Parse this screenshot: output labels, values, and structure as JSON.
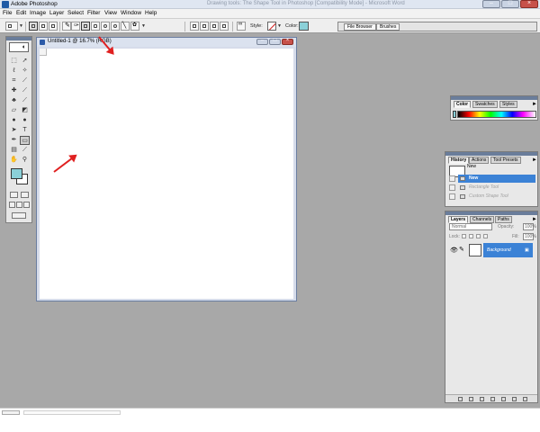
{
  "window": {
    "title": "Adobe Photoshop",
    "background_tab_text": "Drawing tools: The Shape Tool in Photoshop [Compatibility Mode] - Microsoft Word",
    "minimize_glyph": "–",
    "maximize_glyph": "□",
    "close_glyph": "×"
  },
  "menubar": {
    "items": [
      "File",
      "Edit",
      "Image",
      "Layer",
      "Select",
      "Filter",
      "View",
      "Window",
      "Help"
    ]
  },
  "options_bar": {
    "style_label": "Style:",
    "color_label": "Color:",
    "color_value": "#8bd0d8",
    "well_tabs": [
      "File Browser",
      "Brushes"
    ]
  },
  "toolbox": {
    "foreground_color": "#8bd0d8",
    "background_color": "#ffffff",
    "selected_tool": "rectangle-shape-tool"
  },
  "document": {
    "title": "Untitled-1 @ 16.7% (RGB)"
  },
  "color_palette": {
    "tabs": [
      "Color",
      "Swatches",
      "Styles"
    ],
    "active_tab": "Color"
  },
  "history_palette": {
    "tabs": [
      "History",
      "Actions",
      "Tool Presets"
    ],
    "snapshot_label": "New",
    "steps": [
      {
        "label": "New",
        "state": "selected"
      },
      {
        "label": "Rectangle Tool",
        "state": "undone"
      },
      {
        "label": "Custom Shape Tool",
        "state": "undone"
      }
    ]
  },
  "layers_palette": {
    "tabs": [
      "Layers",
      "Channels",
      "Paths"
    ],
    "blend_mode": "Normal",
    "opacity_label": "Opacity:",
    "opacity_value": "100%",
    "lock_label": "Lock:",
    "fill_label": "Fill:",
    "fill_value": "100%",
    "layers": [
      {
        "name": "Background",
        "visible": true,
        "selected": true
      }
    ]
  },
  "palette_menu_glyph": "►",
  "annotations": {
    "arrow_color": "#e02020"
  }
}
